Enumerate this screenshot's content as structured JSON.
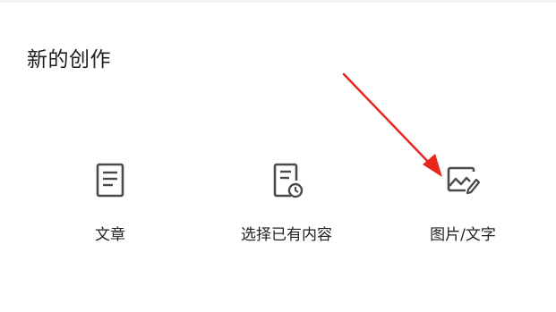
{
  "title": "新的创作",
  "options": [
    {
      "label": "文章",
      "icon": "document-icon"
    },
    {
      "label": "选择已有内容",
      "icon": "document-clock-icon"
    },
    {
      "label": "图片/文字",
      "icon": "image-edit-icon"
    }
  ],
  "colors": {
    "icon": "#4a4a4a",
    "text": "#222222",
    "arrow": "#e8281e"
  }
}
